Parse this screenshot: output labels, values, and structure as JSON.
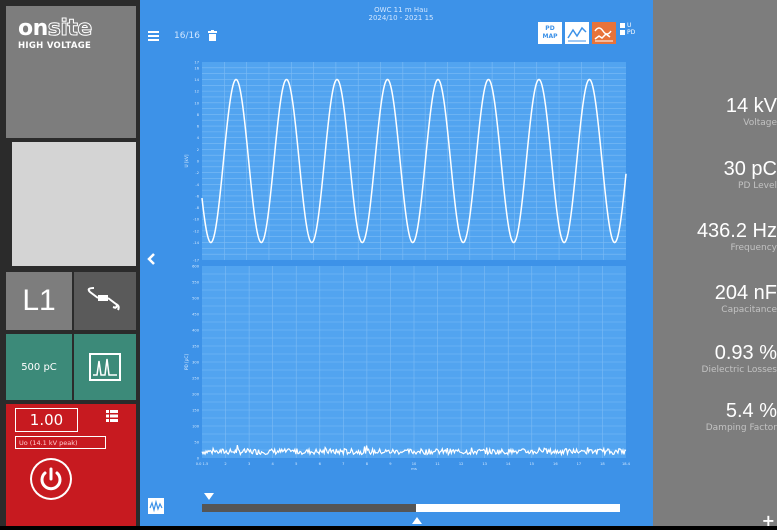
{
  "logo": {
    "brand_a": "on",
    "brand_b": "site",
    "subtitle": "HIGH VOLTAGE"
  },
  "left": {
    "phase_label": "L1",
    "pd_range_label": "500 pC",
    "voltage_value": "1.00",
    "voltage_hint": "Uo (14.1 kV peak)"
  },
  "toolbar": {
    "record_counter": "16/16",
    "title_line1": "OWC 11 m Hau",
    "title_line2": "2024/10 - 2021 15",
    "pd_map_label": "PD\nMAP",
    "legend_u": "U",
    "legend_pd": "PD"
  },
  "chart_data": [
    {
      "type": "line",
      "title": "",
      "ylabel": "U [kV]",
      "xlabel": "",
      "ylim": [
        -17,
        17
      ],
      "y_ticks": [
        17,
        16,
        14,
        12,
        10,
        8,
        6,
        4,
        2,
        0,
        -2,
        -4,
        -6,
        -8,
        -10,
        -12,
        -14,
        -17
      ],
      "x": [
        0,
        1
      ],
      "series": [
        {
          "amplitude_kv": 14,
          "cycles": 8.4
        }
      ]
    },
    {
      "type": "line",
      "title": "",
      "ylabel": "PD [pC]",
      "xlabel": "ms",
      "ylim": [
        0,
        600
      ],
      "y_ticks": [
        600,
        550,
        500,
        450,
        400,
        350,
        300,
        250,
        200,
        150,
        100,
        50,
        0
      ],
      "x_ticks": [
        "0.0 1.5",
        "2",
        "3",
        "4",
        "5",
        "6",
        "7",
        "8",
        "9",
        "10",
        "11",
        "12",
        "13",
        "14",
        "15",
        "16",
        "17",
        "18",
        "18.4"
      ],
      "series": [
        {
          "baseline_pc": 20
        }
      ]
    }
  ],
  "measurements": [
    {
      "value": "14 kV",
      "label": "Voltage"
    },
    {
      "value": "30 pC",
      "label": "PD Level"
    },
    {
      "value": "436.2 Hz",
      "label": "Frequency"
    },
    {
      "value": "204 nF",
      "label": "Capacitance"
    },
    {
      "value": "0.93 %",
      "label": "Dielectric Losses"
    },
    {
      "value": "5.4 %",
      "label": "Damping Factor"
    }
  ],
  "right_bottom_symbol": "+",
  "colors": {
    "panel_blue": "#3d92e8",
    "chart_bg": "#52a4f0",
    "teal": "#3c8a79",
    "red": "#c71a20",
    "orange": "#e8733a"
  }
}
